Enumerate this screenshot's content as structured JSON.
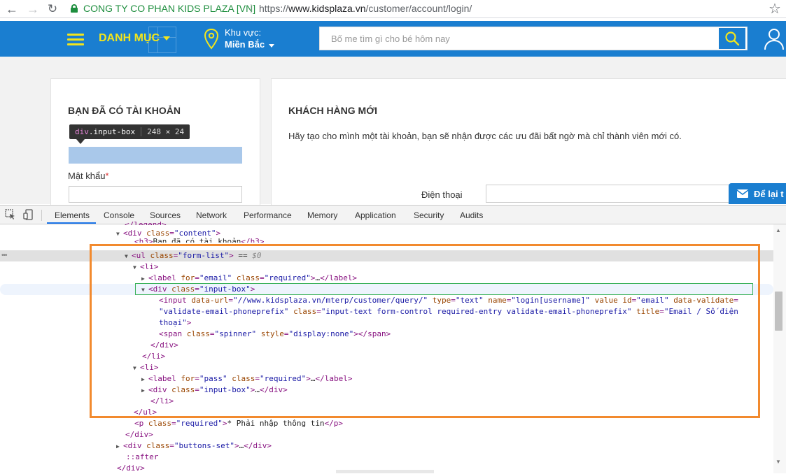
{
  "browser": {
    "site_name": "CONG TY CO PHAN KIDS PLAZA [VN]",
    "url_scheme": "https://",
    "url_host": "www.kidsplaza.vn",
    "url_path": "/customer/account/login/"
  },
  "header": {
    "menu_label": "DANH MỤC",
    "region_label": "Khu vực:",
    "region_value": "Miền Bắc",
    "search_placeholder": "Bố me tìm gì cho bé hôm nay"
  },
  "login": {
    "title": "BẠN ĐÃ CÓ TÀI KHOẢN",
    "password_label": "Mật khẩu",
    "required_mark": "*"
  },
  "register": {
    "title": "KHÁCH HÀNG MỚI",
    "description": "Hãy tạo cho mình một tài khoản, bạn sẽ nhận được các ưu đãi bất ngờ mà chỉ thành viên mới có.",
    "phone_label": "Điện thoại"
  },
  "feedback_label": "Để lại t",
  "inspector_tooltip": {
    "tag": "div",
    "class": ".input-box",
    "size": "248 × 24"
  },
  "devtools": {
    "tabs": [
      "Elements",
      "Console",
      "Sources",
      "Network",
      "Performance",
      "Memory",
      "Application",
      "Security",
      "Audits"
    ],
    "active_tab": "Elements"
  },
  "colors": {
    "brand_blue": "#1a7ed0",
    "brand_yellow": "#f2e51c",
    "annotation_orange": "#f28a2e",
    "selection_green": "#3bb25a"
  }
}
